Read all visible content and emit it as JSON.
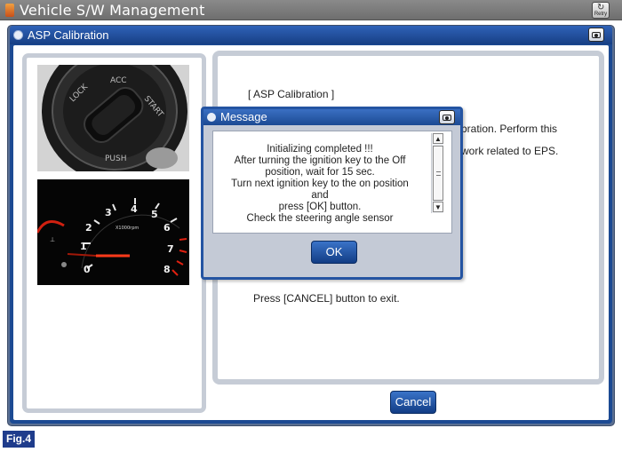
{
  "app": {
    "title": "Vehicle S/W Management",
    "retry_label": "Retry"
  },
  "dialog": {
    "title": "ASP Calibration"
  },
  "content": {
    "heading": "[ ASP Calibration ]",
    "line1_tail": "bration. Perform this",
    "line2_tail": "work related to EPS.",
    "exit_text": "Press [CANCEL] button to exit."
  },
  "message": {
    "title": "Message",
    "lines": [
      "Initializing completed !!!",
      "After turning the ignition key to the Off",
      "position, wait for 15 sec.",
      "Turn next ignition key to the on position",
      "and",
      "press [OK] button.",
      "Check the steering angle sensor"
    ],
    "ok_label": "OK"
  },
  "buttons": {
    "cancel_label": "Cancel"
  },
  "ignition": {
    "labels": [
      "LOCK",
      "ACC",
      "START",
      "PUSH"
    ]
  },
  "cluster": {
    "unit_label": "X1000rpm",
    "ticks": [
      "0",
      "1",
      "2",
      "3",
      "4",
      "5",
      "6",
      "7",
      "8"
    ]
  },
  "figure": {
    "label": "Fig.4"
  },
  "colors": {
    "title_bar": "#7a7a7a",
    "dialog_blue": "#1c4a93",
    "button_blue": "#2a5bb0",
    "panel_border": "#c6ccd6",
    "needle_red": "#e02010"
  }
}
